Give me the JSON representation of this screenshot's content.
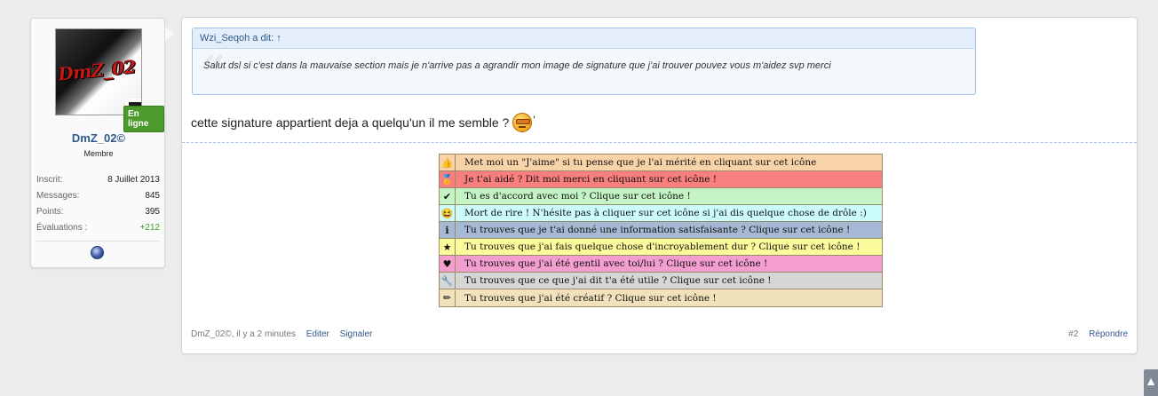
{
  "user": {
    "avatar_logo": "DmZ_02",
    "online_badge": "En ligne",
    "name": "DmZ_02©",
    "title": "Membre",
    "stats": [
      {
        "label": "Inscrit:",
        "value": "8 Juillet 2013"
      },
      {
        "label": "Messages:",
        "value": "845"
      },
      {
        "label": "Points:",
        "value": "395"
      },
      {
        "label": "Évaluations :",
        "value": "+212"
      }
    ]
  },
  "quote": {
    "author_header": "Wzi_Seqoh a dit: ↑",
    "body": "Salut dsl si c'est dans la mauvaise section mais je n'arrive pas a agrandir mon image de signature que j'ai trouver pouvez vous m'aidez svp merci"
  },
  "message": {
    "text": "cette signature appartient deja a quelqu'un il me semble ?",
    "trailing": "'"
  },
  "signature": [
    {
      "icon": "thumbs-up-icon",
      "glyph": "👍",
      "bg": "#f9d3a8",
      "text": "Met moi un \"J'aime\" si tu pense que je l'ai mérité en cliquant sur cet icône"
    },
    {
      "icon": "award-icon",
      "glyph": "🏅",
      "bg": "#f97f7f",
      "text": "Je t'ai aidé ? Dit moi merci en cliquant sur cet icône !"
    },
    {
      "icon": "checkmark-icon",
      "glyph": "✔",
      "bg": "#c4f4c4",
      "text": "Tu es d'accord avec moi ? Clique sur cet icône !"
    },
    {
      "icon": "laughing-smiley-icon",
      "glyph": "😆",
      "bg": "#ccfbfb",
      "text": "Mort de rire ! N'hésite pas à cliquer sur cet icône si j'ai dis quelque chose de drôle :)"
    },
    {
      "icon": "info-icon",
      "glyph": "ℹ",
      "bg": "#a5b8d4",
      "text": "Tu trouves que je t'ai donné une information satisfaisante ? Clique sur cet icône !"
    },
    {
      "icon": "star-icon",
      "glyph": "★",
      "bg": "#fbfb9c",
      "text": "Tu trouves que j'ai fais quelque chose d'incroyablement dur ? Clique sur cet icône !"
    },
    {
      "icon": "heart-icon",
      "glyph": "♥",
      "bg": "#f49ed0",
      "text": "Tu trouves que j'ai été gentil avec toi/lui ? Clique sur cet icône !"
    },
    {
      "icon": "wrench-icon",
      "glyph": "🔧",
      "bg": "#d6d6d6",
      "text": "Tu trouves que ce que j'ai dit t'a été utile ? Clique sur cet icône !"
    },
    {
      "icon": "pencil-icon",
      "glyph": "✏",
      "bg": "#f1e2bc",
      "text": "Tu trouves que j'ai été créatif ? Clique sur cet icône !"
    }
  ],
  "footer": {
    "meta": "DmZ_02©, il y a 2 minutes",
    "edit": "Editer",
    "report": "Signaler",
    "post_number": "#2",
    "reply": "Répondre"
  },
  "scroll_top_glyph": "▲"
}
